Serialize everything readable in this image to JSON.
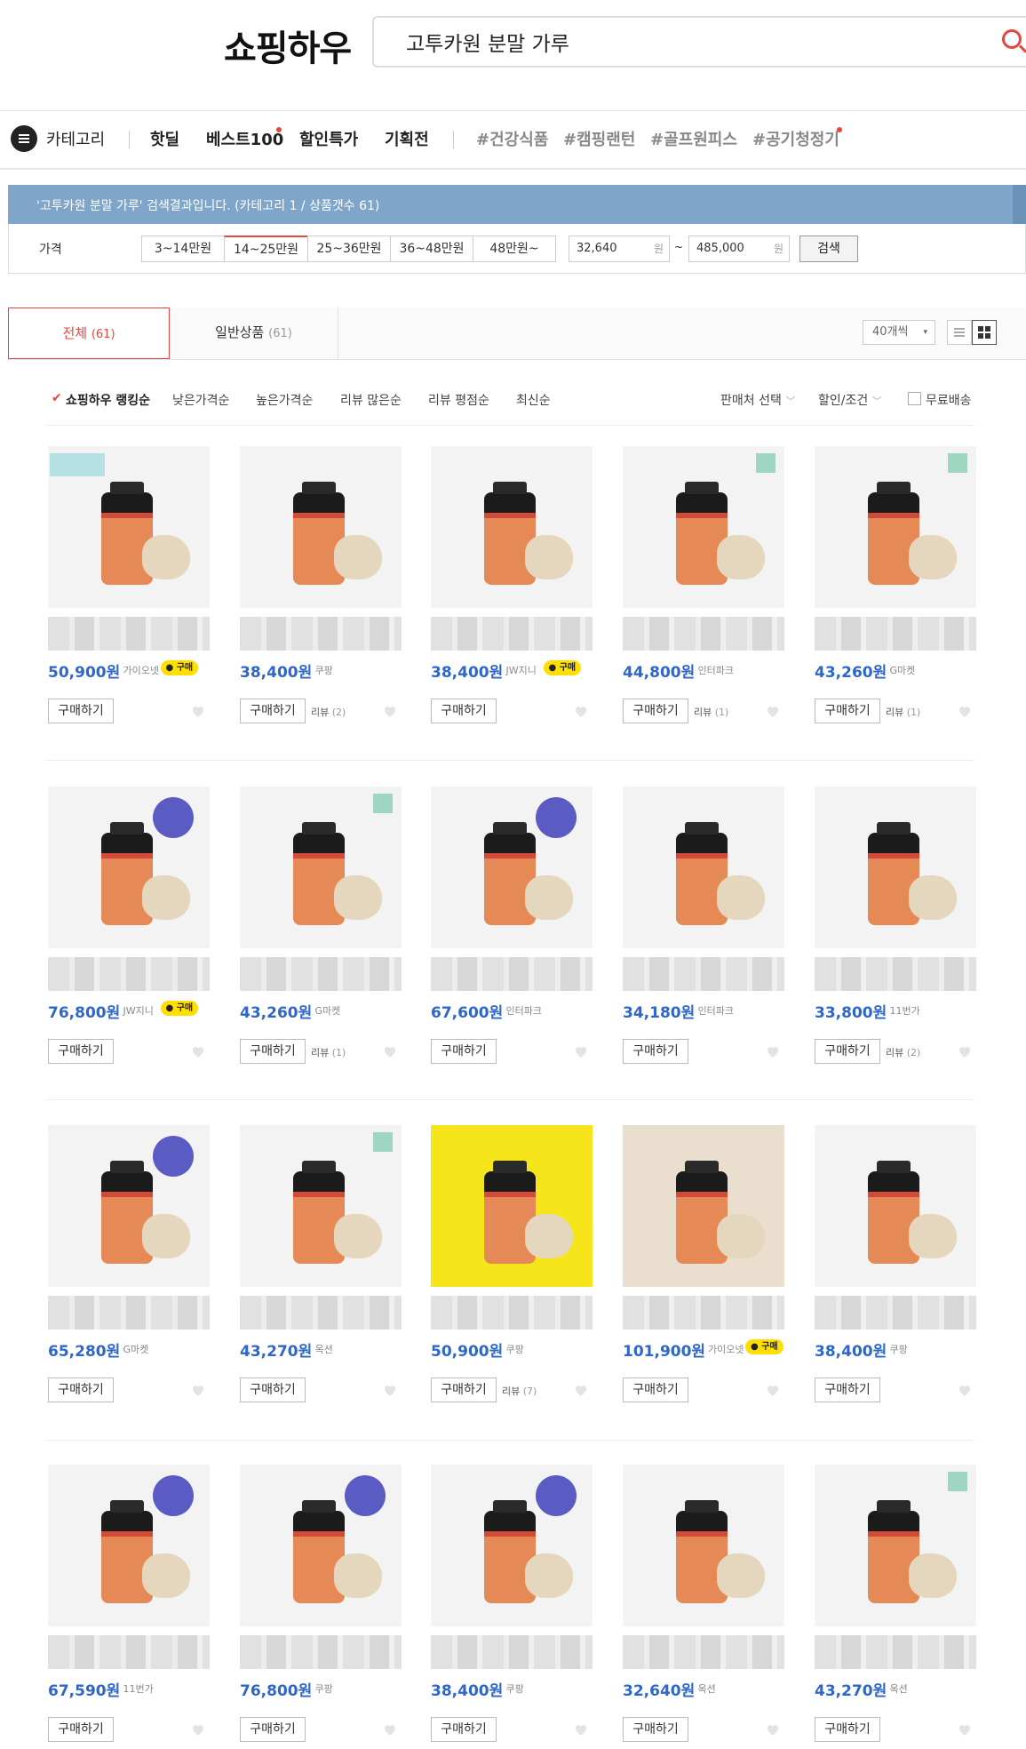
{
  "header": {
    "logo": "쇼핑하우",
    "search_value": "고투카원 분말 가루"
  },
  "nav": {
    "category_label": "카테고리",
    "items": [
      "핫딜",
      "베스트100",
      "할인특가",
      "기획전"
    ],
    "tags": [
      "#건강식품",
      "#캠핑랜턴",
      "#골프원피스",
      "#공기청정기"
    ]
  },
  "results": {
    "text": "'고투카원 분말 가루' 검색결과입니다. (카테고리 1 / 상품갯수 61)"
  },
  "price_filter": {
    "label": "가격",
    "ranges": [
      "3~14만원",
      "14~25만원",
      "25~36만원",
      "36~48만원",
      "48만원~"
    ],
    "min_value": "32,640",
    "max_value": "485,000",
    "unit": "원",
    "tilde": "~",
    "search_button": "검색"
  },
  "tabs": {
    "all_label": "전체",
    "all_count": "(61)",
    "general_label": "일반상품",
    "general_count": "(61)",
    "per_page": "40개씩"
  },
  "sort": {
    "options": [
      "쇼핑하우 랭킹순",
      "낮은가격순",
      "높은가격순",
      "리뷰 많은순",
      "리뷰 평점순",
      "최신순"
    ],
    "seller_select": "판매처 선택",
    "discount": "할인/조건",
    "free_shipping": "무료배송"
  },
  "buy_label": "구매하기",
  "review_label": "리뷰",
  "talk_label": "구매",
  "products": [
    {
      "price": "50,900원",
      "seller": "가이오넷",
      "talk": true,
      "review": "",
      "thumb": "top"
    },
    {
      "price": "38,400원",
      "seller": "쿠팡",
      "talk": false,
      "review": "(2)",
      "thumb": "plain"
    },
    {
      "price": "38,400원",
      "seller": "JW지니",
      "talk": true,
      "review": "",
      "thumb": "plain"
    },
    {
      "price": "44,800원",
      "seller": "인터파크",
      "talk": false,
      "review": "(1)",
      "thumb": "sq"
    },
    {
      "price": "43,260원",
      "seller": "G마켓",
      "talk": false,
      "review": "(1)",
      "thumb": "sq"
    },
    {
      "price": "76,800원",
      "seller": "JW지니",
      "talk": true,
      "review": "",
      "thumb": "circle"
    },
    {
      "price": "43,260원",
      "seller": "G마켓",
      "talk": false,
      "review": "(1)",
      "thumb": "sq"
    },
    {
      "price": "67,600원",
      "seller": "인터파크",
      "talk": false,
      "review": "",
      "thumb": "circle"
    },
    {
      "price": "34,180원",
      "seller": "인터파크",
      "talk": false,
      "review": "",
      "thumb": "plain"
    },
    {
      "price": "33,800원",
      "seller": "11번가",
      "talk": false,
      "review": "(2)",
      "thumb": "plain"
    },
    {
      "price": "65,280원",
      "seller": "G마켓",
      "talk": false,
      "review": "",
      "thumb": "circle"
    },
    {
      "price": "43,270원",
      "seller": "옥션",
      "talk": false,
      "review": "",
      "thumb": "sq"
    },
    {
      "price": "50,900원",
      "seller": "쿠팡",
      "talk": false,
      "review": "(7)",
      "thumb": "yellow"
    },
    {
      "price": "101,900원",
      "seller": "가이오넷",
      "talk": true,
      "review": "",
      "thumb": "scene"
    },
    {
      "price": "38,400원",
      "seller": "쿠팡",
      "talk": false,
      "review": "",
      "thumb": "plain"
    },
    {
      "price": "67,590원",
      "seller": "11번가",
      "talk": false,
      "review": "",
      "thumb": "circle"
    },
    {
      "price": "76,800원",
      "seller": "쿠팡",
      "talk": false,
      "review": "",
      "thumb": "circle"
    },
    {
      "price": "38,400원",
      "seller": "쿠팡",
      "talk": false,
      "review": "",
      "thumb": "circle"
    },
    {
      "price": "32,640원",
      "seller": "옥션",
      "talk": false,
      "review": "",
      "thumb": "plain"
    },
    {
      "price": "43,270원",
      "seller": "옥션",
      "talk": false,
      "review": "",
      "thumb": "sq"
    }
  ],
  "colors": {
    "accent": "#e8453c",
    "price": "#2e66c9",
    "result_bar": "#7fa6c9",
    "talk_badge": "#ffde00"
  }
}
